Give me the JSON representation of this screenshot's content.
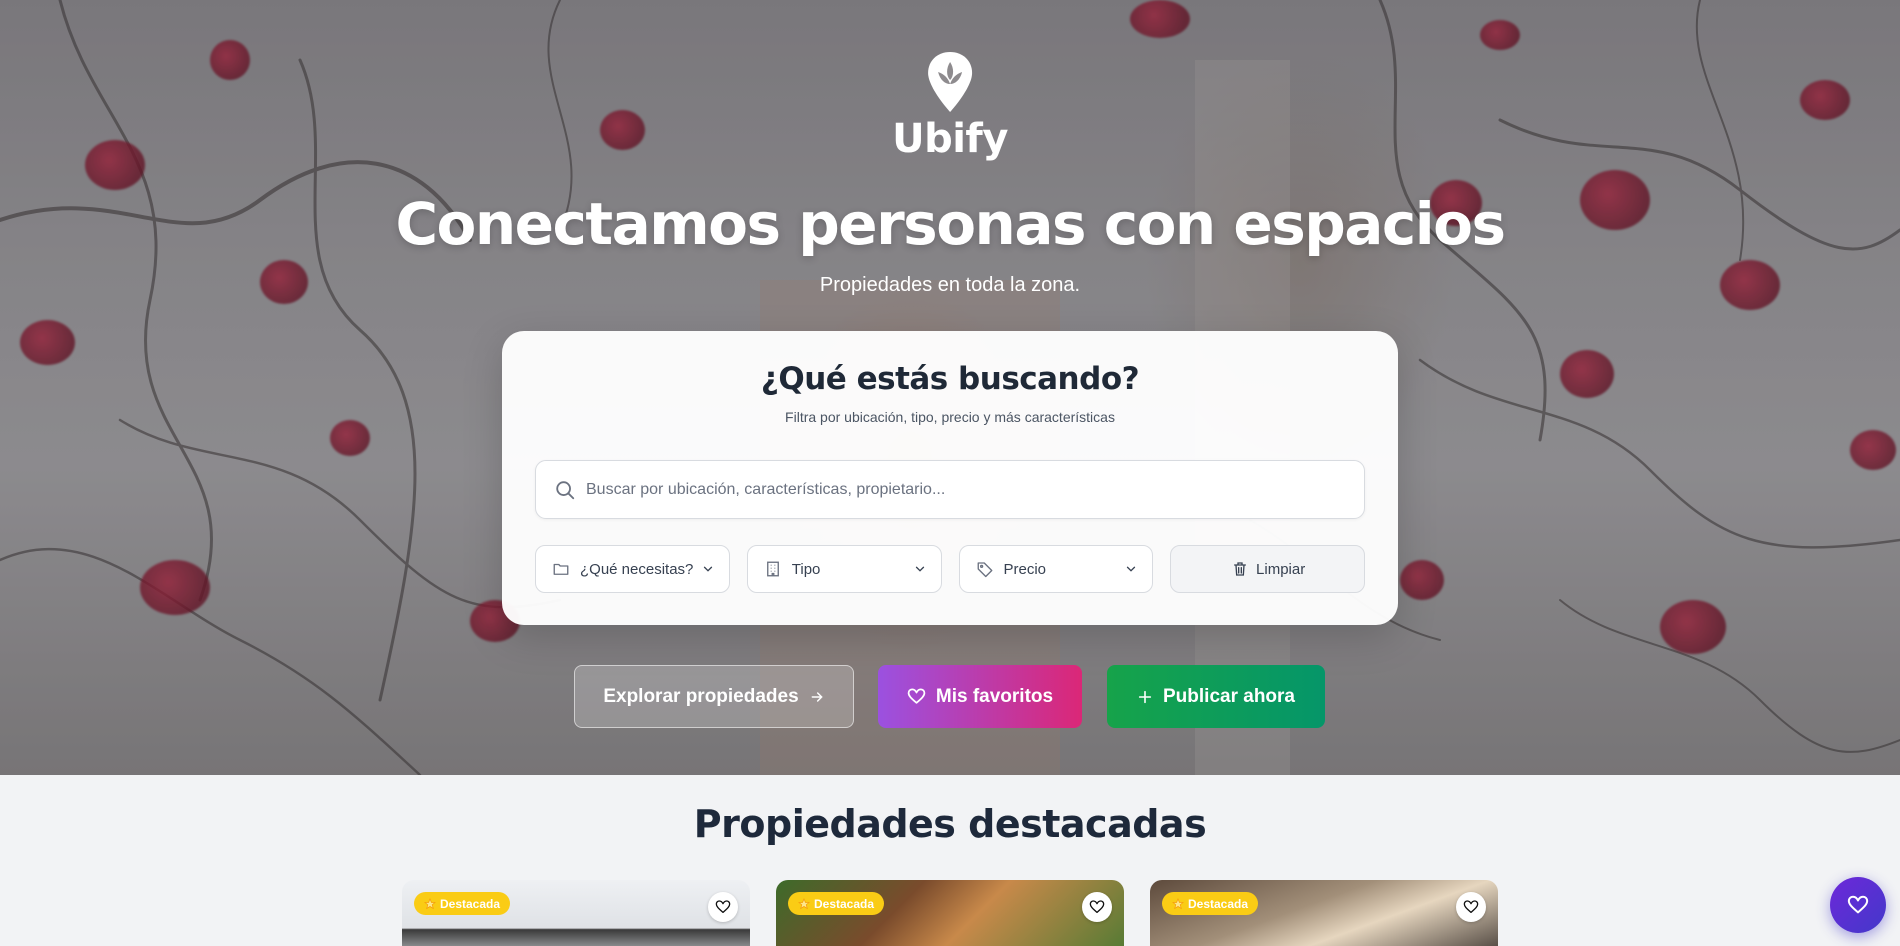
{
  "brand": {
    "name": "Ubify"
  },
  "hero": {
    "headline": "Conectamos personas con espacios",
    "subline": "Propiedades en toda la zona."
  },
  "search": {
    "title": "¿Qué estás buscando?",
    "subtitle": "Filtra por ubicación, tipo, precio y más características",
    "placeholder": "Buscar por ubicación, características, propietario...",
    "value": "",
    "filters": {
      "need": "¿Qué necesitas?",
      "type": "Tipo",
      "price": "Precio",
      "clear": "Limpiar"
    }
  },
  "actions": {
    "explore": "Explorar propiedades",
    "favorites": "Mis favoritos",
    "publish": "Publicar ahora"
  },
  "featured": {
    "title": "Propiedades destacadas",
    "items": [
      {
        "badge": "Destacada"
      },
      {
        "badge": "Destacada"
      },
      {
        "badge": "Destacada"
      }
    ]
  },
  "colors": {
    "favorites_gradient": [
      "#9b51e0",
      "#db2777"
    ],
    "publish_gradient": [
      "#16a34a",
      "#059669"
    ],
    "badge": "#facc15",
    "floating_button": "#5b21b6"
  },
  "icons": [
    "brand-logo-icon",
    "search-icon",
    "folder-icon",
    "building-icon",
    "tag-icon",
    "chevron-down-icon",
    "trash-icon",
    "arrow-right-icon",
    "heart-icon",
    "plus-icon",
    "star-icon"
  ]
}
